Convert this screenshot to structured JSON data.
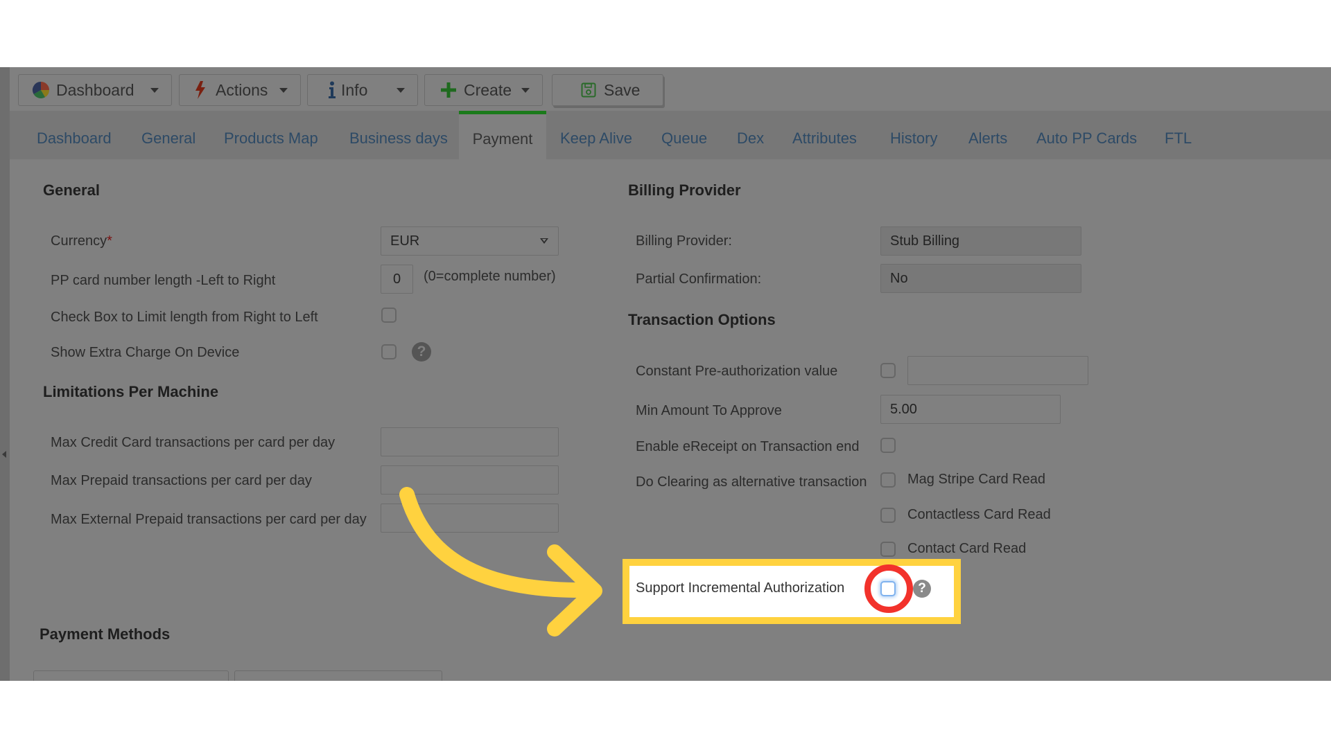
{
  "toolbar": {
    "buttons": [
      {
        "label": "Dashboard",
        "icon": "pie-chart-icon",
        "has_dropdown": true
      },
      {
        "label": "Actions",
        "icon": "lightning-icon",
        "has_dropdown": true
      },
      {
        "label": "Info",
        "icon": "info-icon",
        "has_dropdown": true
      },
      {
        "label": "Create",
        "icon": "plus-icon",
        "has_dropdown": true
      },
      {
        "label": "Save",
        "icon": "floppy-disk-icon",
        "has_dropdown": false
      }
    ]
  },
  "tabs": [
    {
      "label": "Dashboard"
    },
    {
      "label": "General"
    },
    {
      "label": "Products Map"
    },
    {
      "label": "Business days"
    },
    {
      "label": "Payment",
      "active": true
    },
    {
      "label": "Keep Alive"
    },
    {
      "label": "Queue"
    },
    {
      "label": "Dex"
    },
    {
      "label": "Attributes"
    },
    {
      "label": "History"
    },
    {
      "label": "Alerts"
    },
    {
      "label": "Auto PP Cards"
    },
    {
      "label": "FTL"
    }
  ],
  "general": {
    "title": "General",
    "currency": {
      "label": "Currency",
      "required_mark": "*",
      "value": "EUR"
    },
    "pp_card_length": {
      "label": "PP card number length -Left to Right",
      "value": "0",
      "hint": "(0=complete number)"
    },
    "limit_right_to_left": {
      "label": "Check Box to Limit length from Right to Left",
      "checked": false
    },
    "show_extra_charge": {
      "label": "Show Extra Charge On Device",
      "checked": false,
      "help": "?"
    }
  },
  "limitations": {
    "title": "Limitations Per Machine",
    "fields": [
      {
        "label": "Max Credit Card transactions per card per day",
        "value": ""
      },
      {
        "label": "Max Prepaid transactions per card per day",
        "value": ""
      },
      {
        "label": "Max External Prepaid transactions per card per day",
        "value": ""
      }
    ]
  },
  "payment_methods": {
    "title": "Payment Methods"
  },
  "billing_provider": {
    "title": "Billing Provider",
    "provider": {
      "label": "Billing Provider:",
      "value": "Stub Billing"
    },
    "partial_confirmation": {
      "label": "Partial Confirmation:",
      "value": "No"
    }
  },
  "transaction_options": {
    "title": "Transaction Options",
    "constant_preauth": {
      "label": "Constant Pre-authorization value",
      "checked": false,
      "value": ""
    },
    "min_amount": {
      "label": "Min Amount To Approve",
      "value": "5.00"
    },
    "ereceipt": {
      "label": "Enable eReceipt on Transaction end",
      "checked": false
    },
    "do_clearing": {
      "label": "Do Clearing as alternative transaction",
      "options": [
        {
          "label": "Mag Stripe Card Read",
          "checked": false
        },
        {
          "label": "Contactless Card Read",
          "checked": false
        },
        {
          "label": "Contact Card Read",
          "checked": false
        }
      ]
    },
    "incremental_auth": {
      "label": "Support Incremental Authorization",
      "checked": false,
      "help": "?"
    }
  },
  "annotation": {
    "highlight_color": "#ffd23f",
    "circle_color": "#f2322b",
    "arrow_color": "#ffd23f",
    "target": "incremental_auth"
  },
  "colors": {
    "active_tab_indicator": "#1a7a1a",
    "tab_link": "#2d4a66"
  }
}
